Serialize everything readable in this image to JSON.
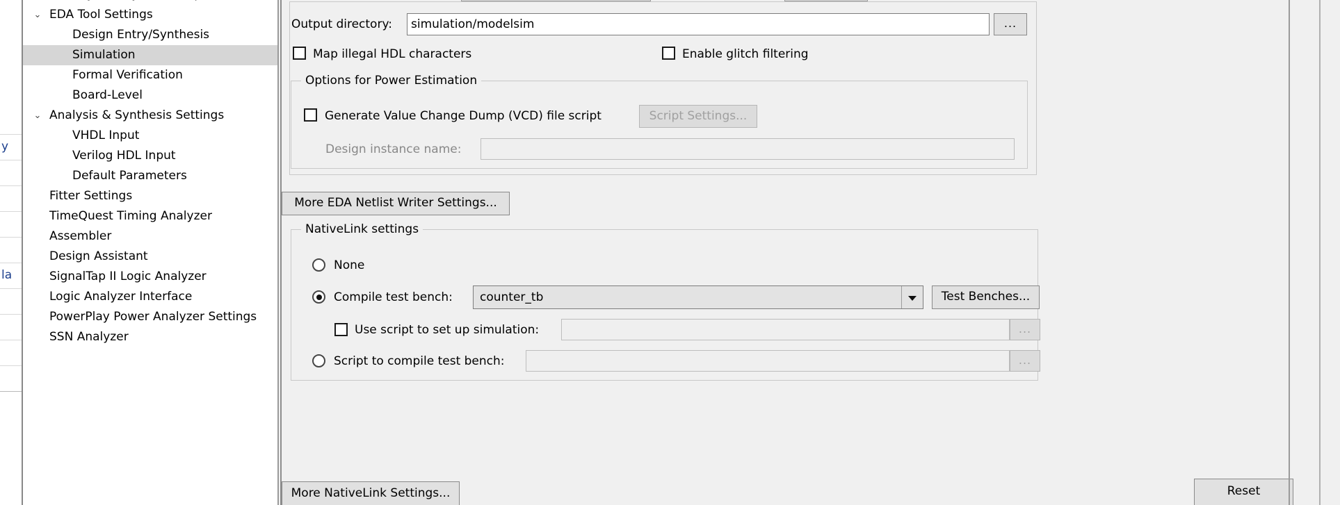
{
  "background_panel": {
    "rows": [
      "",
      "y",
      "",
      "",
      "",
      "",
      "la",
      "",
      "",
      "",
      ""
    ]
  },
  "tree": {
    "items": [
      {
        "label": "Physical Synthesis Optimizations",
        "level": 1,
        "twisty": "",
        "selected": false
      },
      {
        "label": "EDA Tool Settings",
        "level": 0,
        "twisty": "⌄",
        "selected": false
      },
      {
        "label": "Design Entry/Synthesis",
        "level": 1,
        "twisty": "",
        "selected": false
      },
      {
        "label": "Simulation",
        "level": 1,
        "twisty": "",
        "selected": true
      },
      {
        "label": "Formal Verification",
        "level": 1,
        "twisty": "",
        "selected": false
      },
      {
        "label": "Board-Level",
        "level": 1,
        "twisty": "",
        "selected": false
      },
      {
        "label": "Analysis & Synthesis Settings",
        "level": 0,
        "twisty": "⌄",
        "selected": false
      },
      {
        "label": "VHDL Input",
        "level": 1,
        "twisty": "",
        "selected": false
      },
      {
        "label": "Verilog HDL Input",
        "level": 1,
        "twisty": "",
        "selected": false
      },
      {
        "label": "Default Parameters",
        "level": 1,
        "twisty": "",
        "selected": false
      },
      {
        "label": "Fitter Settings",
        "level": 0,
        "twisty": "",
        "selected": false
      },
      {
        "label": "TimeQuest Timing Analyzer",
        "level": 0,
        "twisty": "",
        "selected": false
      },
      {
        "label": "Assembler",
        "level": 0,
        "twisty": "",
        "selected": false
      },
      {
        "label": "Design Assistant",
        "level": 0,
        "twisty": "",
        "selected": false
      },
      {
        "label": "SignalTap II Logic Analyzer",
        "level": 0,
        "twisty": "",
        "selected": false
      },
      {
        "label": "Logic Analyzer Interface",
        "level": 0,
        "twisty": "",
        "selected": false
      },
      {
        "label": "PowerPlay Power Analyzer Settings",
        "level": 0,
        "twisty": "",
        "selected": false
      },
      {
        "label": "SSN Analyzer",
        "level": 0,
        "twisty": "",
        "selected": false
      }
    ]
  },
  "simulation": {
    "output_directory": {
      "label": "Output directory:",
      "value": "simulation/modelsim",
      "browse_label": "..."
    },
    "map_illegal_hdl": {
      "label": "Map illegal HDL characters",
      "checked": false
    },
    "enable_glitch_filtering": {
      "label": "Enable glitch filtering",
      "checked": false
    },
    "power_estimation": {
      "title": "Options for Power Estimation",
      "generate_vcd": {
        "label": "Generate Value Change Dump (VCD) file script",
        "checked": false
      },
      "script_settings_button": "Script Settings...",
      "design_instance_name": {
        "label": "Design instance name:",
        "value": ""
      }
    },
    "more_eda_netlist_writer_button": "More EDA Netlist Writer Settings...",
    "nativelink": {
      "title": "NativeLink settings",
      "selected_option": "compile_test_bench",
      "options": [
        {
          "id": "none",
          "label": "None"
        },
        {
          "id": "compile_test_bench",
          "label": "Compile test bench:"
        },
        {
          "id": "script_to_compile",
          "label": "Script to compile test bench:"
        }
      ],
      "test_bench_combo_value": "counter_tb",
      "test_benches_button": "Test Benches...",
      "use_script": {
        "label": "Use script to set up simulation:",
        "checked": false,
        "value": "",
        "browse_label": "..."
      },
      "script_to_compile": {
        "value": "",
        "browse_label": "..."
      }
    },
    "more_nativelink_button": "More NativeLink Settings...",
    "reset_button": "Reset"
  }
}
